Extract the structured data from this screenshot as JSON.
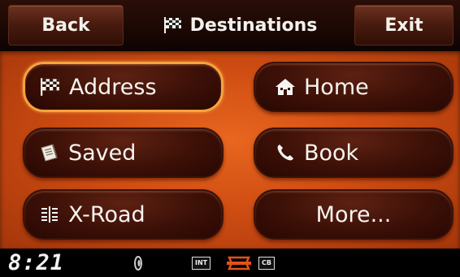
{
  "header": {
    "back_label": "Back",
    "title": "Destinations",
    "exit_label": "Exit",
    "title_icon": "checkered-flag-icon"
  },
  "menu": {
    "address_label": "Address",
    "address_icon": "checkered-flag-icon",
    "home_label": "Home",
    "home_icon": "house-icon",
    "saved_label": "Saved",
    "saved_icon": "address-book-icon",
    "book_label": "Book",
    "book_icon": "phone-handset-icon",
    "xroad_label": "X-Road",
    "xroad_icon": "crossroads-icon",
    "more_label": "More...",
    "selected": "address"
  },
  "status": {
    "time": "8:21",
    "int_badge": "INT",
    "cb_badge": "CB",
    "icons": [
      "speaker-icon",
      "harley-logo-icon"
    ]
  },
  "colors": {
    "panel_orange": "#d85515",
    "button_brown": "#3c1007",
    "selected_outline": "#f5a43c",
    "text": "#f7f4ef"
  }
}
